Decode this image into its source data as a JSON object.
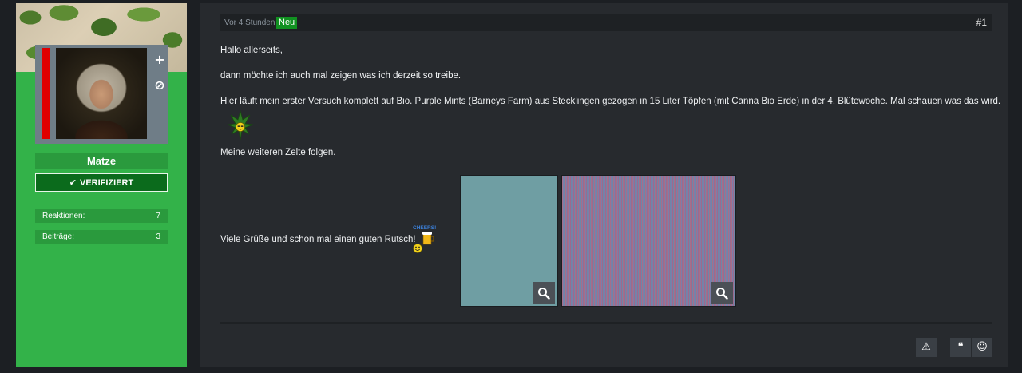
{
  "user": {
    "name": "Matze",
    "badge": "VERIFIZIERT",
    "stats": [
      {
        "label": "Reaktionen:",
        "value": "7"
      },
      {
        "label": "Beiträge:",
        "value": "3"
      }
    ],
    "actions": {
      "follow": "+",
      "ignore": "⊘"
    }
  },
  "post": {
    "time": "Vor 4 Stunden",
    "new_label": "Neu",
    "number": "#1",
    "lines": [
      "Hallo allerseits,",
      "dann möchte ich auch mal zeigen was ich derzeit so treibe.",
      "Hier läuft mein erster Versuch komplett auf Bio. Purple Mints (Barneys Farm) aus Stecklingen gezogen in 15 Liter Töpfen (mit Canna Bio Erde) in der 4. Blütewoche. Mal schauen was das wird.",
      "Meine weiteren Zelte folgen.",
      "Viele Grüße und schon mal einen guten Rutsch!"
    ],
    "cheers_label": "CHEERS!",
    "attachments": [
      {
        "icon": "zoom-icon",
        "color": "#6f9ea3"
      },
      {
        "icon": "zoom-icon",
        "color": "#a56f8a"
      }
    ],
    "actions": {
      "report": "⚠",
      "quote": "❝",
      "react": "☺"
    }
  },
  "colors": {
    "page_bg": "#1c1f23",
    "sidebar_green": "#33b249",
    "verified_green": "#0b6b1c",
    "new_badge": "#119121",
    "post_bg": "#272a2e"
  }
}
